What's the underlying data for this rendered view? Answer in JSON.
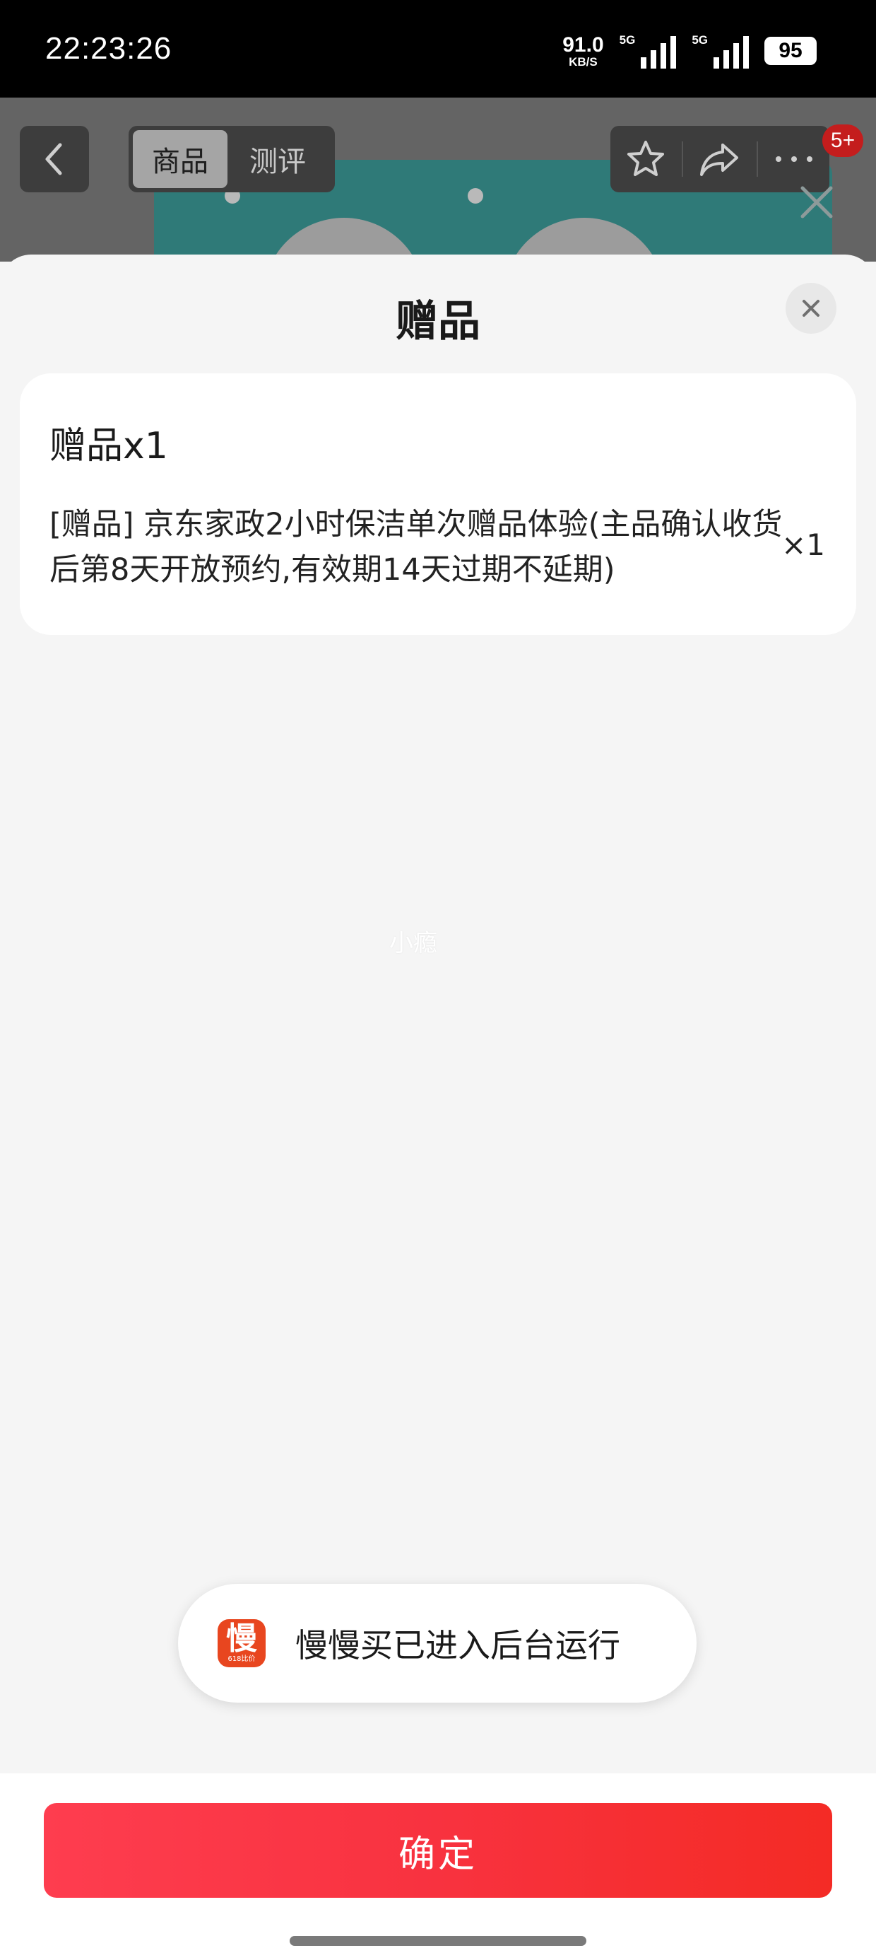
{
  "status_bar": {
    "time": "22:23:26",
    "net_speed_value": "91.0",
    "net_speed_unit": "KB/S",
    "sim1_tag": "5G",
    "sim2_tag": "5G",
    "battery": "95"
  },
  "product_nav": {
    "tabs": [
      {
        "label": "商品",
        "active": true
      },
      {
        "label": "测评",
        "active": false
      }
    ],
    "cart_badge": "5+",
    "icons": [
      "back-icon",
      "star-icon",
      "share-icon",
      "more-icon",
      "close-icon"
    ]
  },
  "sheet": {
    "title": "赠品",
    "gift_section_title": "赠品x1",
    "gift_item": {
      "description": "[赠品] 京东家政2小时保洁单次赠品体验(主品确认收货后第8天开放预约,有效期14天过期不延期)",
      "quantity": "×1"
    },
    "watermark": "小瘾"
  },
  "toast": {
    "app_icon_glyph": "慢",
    "app_icon_subtext": "618比价",
    "message": "慢慢买已进入后台运行"
  },
  "footer": {
    "confirm_label": "确定"
  },
  "colors": {
    "confirm_gradient_start": "#fe3d4f",
    "confirm_gradient_end": "#f42b25",
    "badge": "#c41d1d",
    "toast_icon": "#e8461f"
  }
}
